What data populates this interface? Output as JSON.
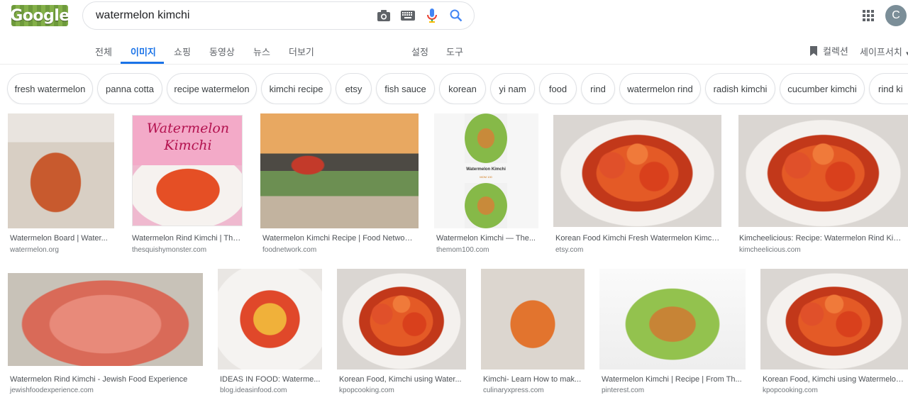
{
  "header": {
    "logo_text": "Google",
    "query": "watermelon kimchi",
    "avatar_letter": "C"
  },
  "tabs": [
    {
      "label": "전체"
    },
    {
      "label": "이미지"
    },
    {
      "label": "쇼핑"
    },
    {
      "label": "동영상"
    },
    {
      "label": "뉴스"
    },
    {
      "label": "더보기"
    },
    {
      "label": "설정"
    },
    {
      "label": "도구"
    }
  ],
  "right_tools": {
    "collections": "컬렉션",
    "safesearch": "세이프서치"
  },
  "chips": [
    "fresh watermelon",
    "panna cotta",
    "recipe watermelon",
    "kimchi recipe",
    "etsy",
    "fish sauce",
    "korean",
    "yi nam",
    "food",
    "rind",
    "watermelon rind",
    "radish kimchi",
    "cucumber kimchi",
    "rind ki"
  ],
  "thumbnail_text": {
    "pink_title": "Watermelon Kimchi",
    "mini_title": "Watermelon Kimchi",
    "mini_sub": "MOM 100"
  },
  "results": [
    {
      "caption": "Watermelon Board | Water...",
      "source": "watermelon.org"
    },
    {
      "caption": "Watermelon Rind Kimchi | The...",
      "source": "thesquishymonster.com"
    },
    {
      "caption": "Watermelon Kimchi Recipe | Food Network...",
      "source": "foodnetwork.com"
    },
    {
      "caption": "Watermelon Kimchi — The...",
      "source": "themom100.com"
    },
    {
      "caption": "Korean Food Kimchi Fresh Watermelon Kimch...",
      "source": "etsy.com"
    },
    {
      "caption": "Kimcheelicious: Recipe: Watermelon Rind Kim...",
      "source": "kimcheelicious.com"
    },
    {
      "caption": "Watermelon Rind Kimchi - Jewish Food Experience",
      "source": "jewishfoodexperience.com"
    },
    {
      "caption": "IDEAS IN FOOD: Waterme...",
      "source": "blog.ideasinfood.com"
    },
    {
      "caption": "Korean Food, Kimchi using Water...",
      "source": "kpopcooking.com"
    },
    {
      "caption": "Kimchi- Learn How to mak...",
      "source": "culinaryxpress.com"
    },
    {
      "caption": "Watermelon Kimchi | Recipe | From Th...",
      "source": "pinterest.com"
    },
    {
      "caption": "Korean Food, Kimchi using Watermelon...",
      "source": "kpopcooking.com"
    }
  ]
}
